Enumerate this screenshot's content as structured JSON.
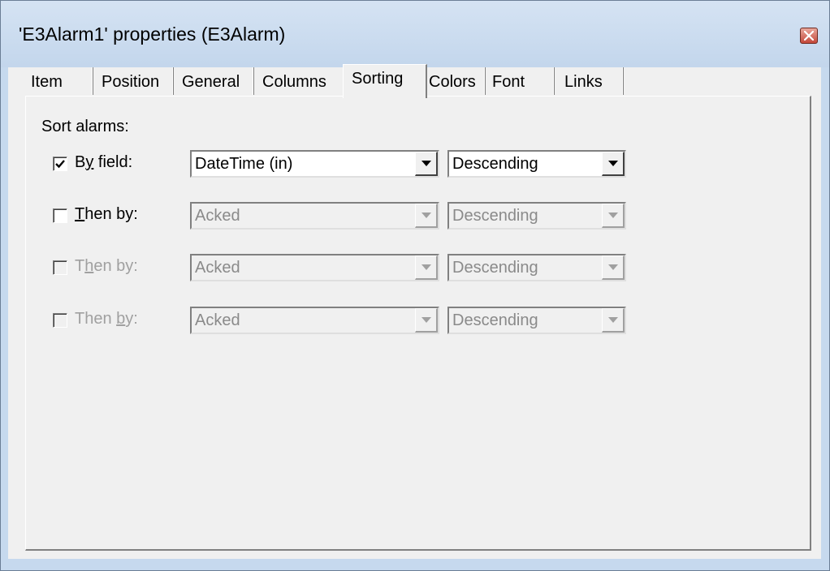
{
  "window": {
    "title": "'E3Alarm1' properties (E3Alarm)",
    "close_icon": "close-icon"
  },
  "tabs": [
    {
      "label": "Item",
      "active": false
    },
    {
      "label": "Position",
      "active": false
    },
    {
      "label": "General",
      "active": false
    },
    {
      "label": "Columns",
      "active": false
    },
    {
      "label": "Sorting",
      "active": true
    },
    {
      "label": "Colors",
      "active": false
    },
    {
      "label": "Font",
      "active": false
    },
    {
      "label": "Links",
      "active": false
    }
  ],
  "sorting": {
    "section_label": "Sort alarms:",
    "rows": [
      {
        "label_pre": "B",
        "label_key": "y",
        "label_post": " field:",
        "checked": true,
        "enabled": true,
        "field": "DateTime (in)",
        "order": "Descending"
      },
      {
        "label_pre": "",
        "label_key": "T",
        "label_post": "hen by:",
        "checked": false,
        "enabled": true,
        "field": "Acked",
        "order": "Descending"
      },
      {
        "label_pre": "T",
        "label_key": "h",
        "label_post": "en by:",
        "checked": false,
        "enabled": false,
        "field": "Acked",
        "order": "Descending"
      },
      {
        "label_pre": "Then ",
        "label_key": "b",
        "label_post": "y:",
        "checked": false,
        "enabled": false,
        "field": "Acked",
        "order": "Descending"
      }
    ]
  }
}
